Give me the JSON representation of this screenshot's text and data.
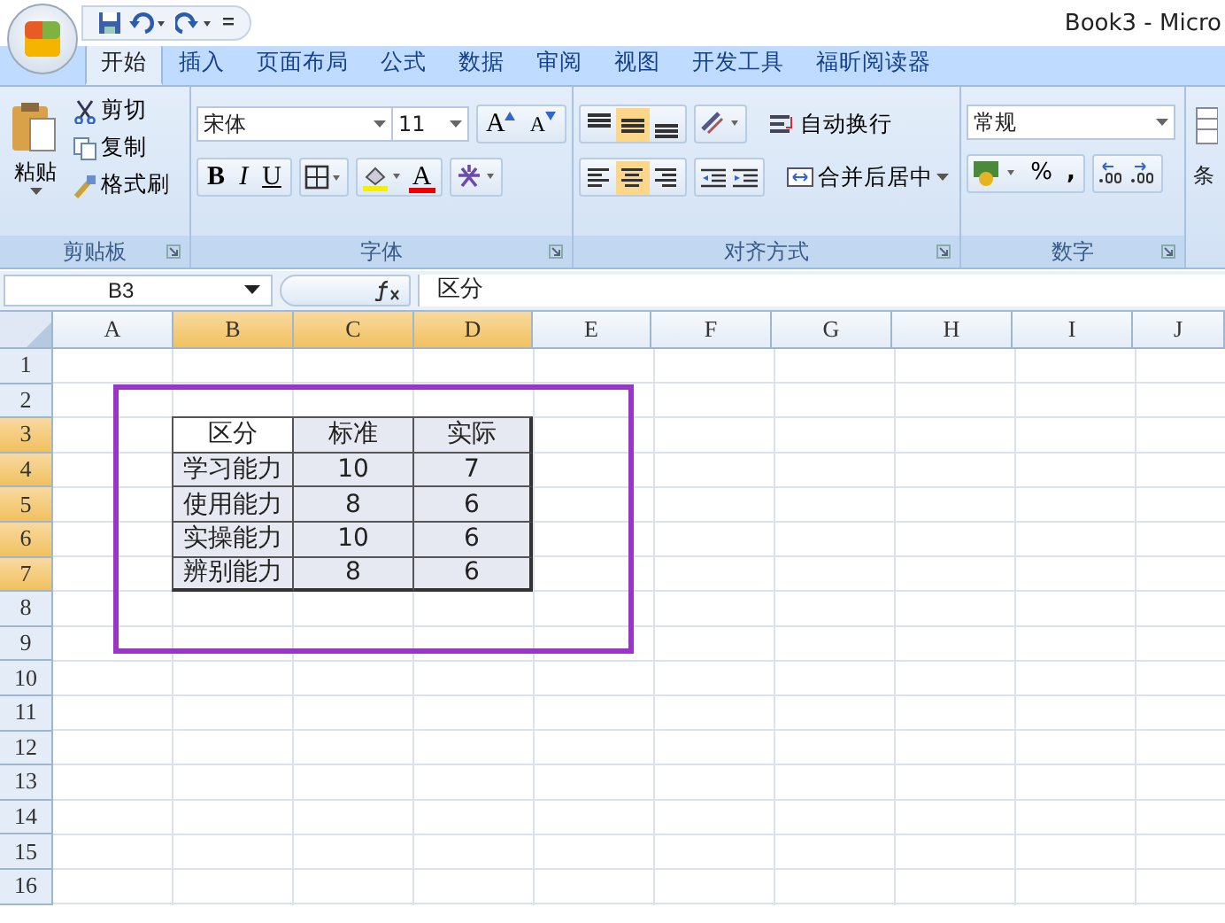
{
  "window": {
    "title": "Book3 - Micro"
  },
  "tabs": [
    {
      "label": "开始",
      "selected": true
    },
    {
      "label": "插入",
      "selected": false
    },
    {
      "label": "页面布局",
      "selected": false
    },
    {
      "label": "公式",
      "selected": false
    },
    {
      "label": "数据",
      "selected": false
    },
    {
      "label": "审阅",
      "selected": false
    },
    {
      "label": "视图",
      "selected": false
    },
    {
      "label": "开发工具",
      "selected": false
    },
    {
      "label": "福昕阅读器",
      "selected": false
    }
  ],
  "clipboard": {
    "title": "剪贴板",
    "paste": "粘贴",
    "cut": "剪切",
    "copy": "复制",
    "format_painter": "格式刷"
  },
  "font": {
    "title": "字体",
    "font_name": "宋体",
    "font_size": "11",
    "grow": "A",
    "shrink": "A",
    "bold": "B",
    "italic": "I",
    "underline": "U",
    "font_color": "A"
  },
  "alignment": {
    "title": "对齐方式",
    "vertical": [
      {
        "kind": "top",
        "selected": false
      },
      {
        "kind": "middle",
        "selected": true
      },
      {
        "kind": "bottom",
        "selected": false
      }
    ],
    "horizontal": [
      {
        "kind": "left",
        "selected": false
      },
      {
        "kind": "center",
        "selected": true
      },
      {
        "kind": "right",
        "selected": false
      }
    ],
    "wrap": "自动换行",
    "merge": "合并后居中"
  },
  "number": {
    "title": "数字",
    "format": "常规",
    "percent": "%",
    "comma": ","
  },
  "next_group": {
    "label": "条"
  },
  "formula_bar": {
    "name_box": "B3",
    "value": "区分"
  },
  "sheet": {
    "columns": [
      {
        "label": "A",
        "selected": false
      },
      {
        "label": "B",
        "selected": true
      },
      {
        "label": "C",
        "selected": true
      },
      {
        "label": "D",
        "selected": true
      },
      {
        "label": "E",
        "selected": false
      },
      {
        "label": "F",
        "selected": false
      },
      {
        "label": "G",
        "selected": false
      },
      {
        "label": "H",
        "selected": false
      },
      {
        "label": "I",
        "selected": false
      },
      {
        "label": "J",
        "selected": false
      }
    ],
    "rows": [
      {
        "label": "1",
        "selected": false
      },
      {
        "label": "2",
        "selected": false
      },
      {
        "label": "3",
        "selected": true,
        "cells": [
          {
            "text": "区分",
            "active": true
          },
          {
            "text": "标准",
            "active": false
          },
          {
            "text": "实际",
            "active": false
          }
        ]
      },
      {
        "label": "4",
        "selected": true,
        "cells": [
          {
            "text": "学习能力",
            "active": false
          },
          {
            "text": "10",
            "active": false
          },
          {
            "text": "7",
            "active": false
          }
        ]
      },
      {
        "label": "5",
        "selected": true,
        "cells": [
          {
            "text": "使用能力",
            "active": false
          },
          {
            "text": "8",
            "active": false
          },
          {
            "text": "6",
            "active": false
          }
        ]
      },
      {
        "label": "6",
        "selected": true,
        "cells": [
          {
            "text": "实操能力",
            "active": false
          },
          {
            "text": "10",
            "active": false
          },
          {
            "text": "6",
            "active": false
          }
        ]
      },
      {
        "label": "7",
        "selected": true,
        "cells": [
          {
            "text": "辨别能力",
            "active": false
          },
          {
            "text": "8",
            "active": false
          },
          {
            "text": "6",
            "active": false
          }
        ]
      },
      {
        "label": "8",
        "selected": false
      },
      {
        "label": "9",
        "selected": false
      },
      {
        "label": "10",
        "selected": false
      },
      {
        "label": "11",
        "selected": false
      },
      {
        "label": "12",
        "selected": false
      },
      {
        "label": "13",
        "selected": false
      },
      {
        "label": "14",
        "selected": false
      },
      {
        "label": "15",
        "selected": false
      },
      {
        "label": "16",
        "selected": false
      }
    ]
  },
  "annotation": {
    "kind": "rectangle"
  }
}
